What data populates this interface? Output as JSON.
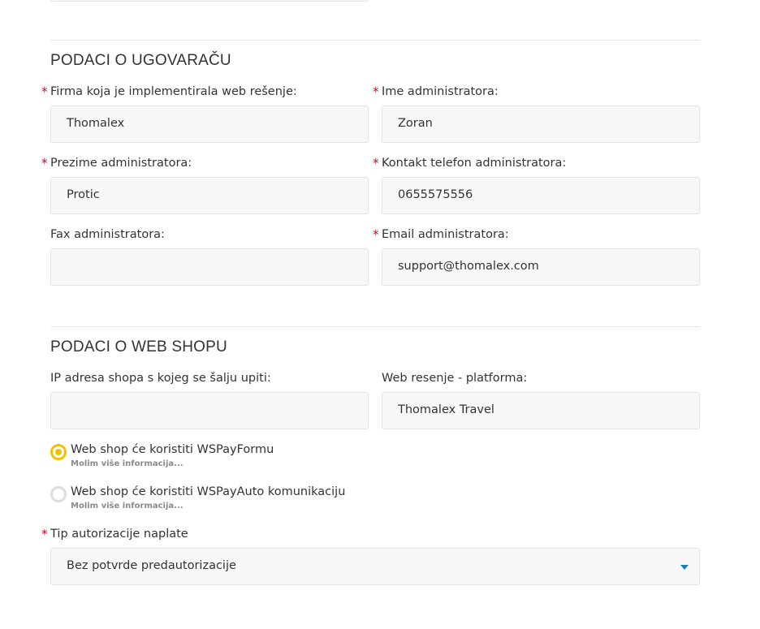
{
  "section_contractor": {
    "title": "PODACI O UGOVARAČU",
    "company_label": "Firma koja je implementirala web rešenje:",
    "company_value": "Thomalex",
    "admin_name_label": "Ime administratora:",
    "admin_name_value": "Zoran",
    "admin_surname_label": "Prezime administratora:",
    "admin_surname_value": "Protic",
    "admin_phone_label": "Kontakt telefon administratora:",
    "admin_phone_value": "0655575556",
    "admin_fax_label": "Fax administratora:",
    "admin_fax_value": "",
    "admin_email_label": "Email administratora:",
    "admin_email_value": "support@thomalex.com"
  },
  "section_webshop": {
    "title": "PODACI O WEB SHOPU",
    "ip_label": "IP adresa shopa s kojeg se šalju upiti:",
    "ip_value": "",
    "platform_label": "Web resenje - platforma:",
    "platform_value": "Thomalex Travel",
    "radio_options": [
      {
        "label": "Web shop će koristiti WSPayFormu",
        "more": "Molim više informacija...",
        "selected": true
      },
      {
        "label": "Web shop će koristiti WSPayAuto komunikaciju",
        "more": "Molim više informacija...",
        "selected": false
      }
    ],
    "auth_type_label": "Tip autorizacije naplate",
    "auth_type_value": "Bez potvrde predautorizacije"
  },
  "required_marker": "*",
  "colors": {
    "required": "#d0021b",
    "radio_selected": "#f2c200",
    "caret": "#1a7db8"
  }
}
